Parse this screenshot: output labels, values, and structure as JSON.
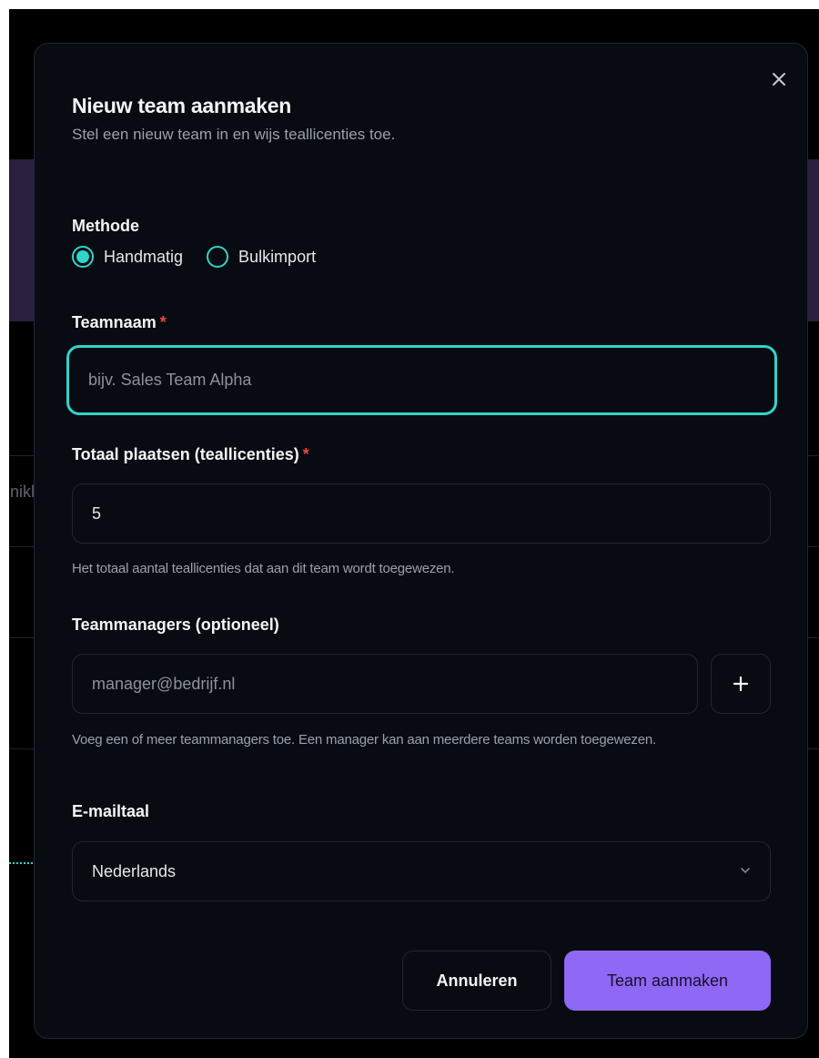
{
  "background": {
    "partial_text": "nikl"
  },
  "dialog": {
    "title": "Nieuw team aanmaken",
    "subtitle": "Stel een nieuw team in en wijs teallicenties toe.",
    "close_icon": "close-icon"
  },
  "method": {
    "label": "Methode",
    "options": [
      {
        "label": "Handmatig",
        "selected": true
      },
      {
        "label": "Bulkimport",
        "selected": false
      }
    ]
  },
  "team_name": {
    "label": "Teamnaam",
    "required_mark": "*",
    "placeholder": "bijv. Sales Team Alpha",
    "value": ""
  },
  "seats": {
    "label": "Totaal plaatsen (teallicenties)",
    "required_mark": "*",
    "value": "5",
    "help": "Het totaal aantal teallicenties dat aan dit team wordt toegewezen."
  },
  "managers": {
    "label": "Teammanagers (optioneel)",
    "placeholder": "manager@bedrijf.nl",
    "add_icon": "plus-icon",
    "help": "Voeg een of meer teammanagers toe. Een manager kan aan meerdere teams worden toegewezen."
  },
  "email_language": {
    "label": "E-mailtaal",
    "selected": "Nederlands",
    "icon": "chevron-down-icon"
  },
  "actions": {
    "cancel_label": "Annuleren",
    "submit_label": "Team aanmaken"
  },
  "colors": {
    "accent": "#2fd5c9",
    "primary_button": "#8f68f5",
    "required": "#ef4444",
    "modal_bg": "#080b12"
  }
}
